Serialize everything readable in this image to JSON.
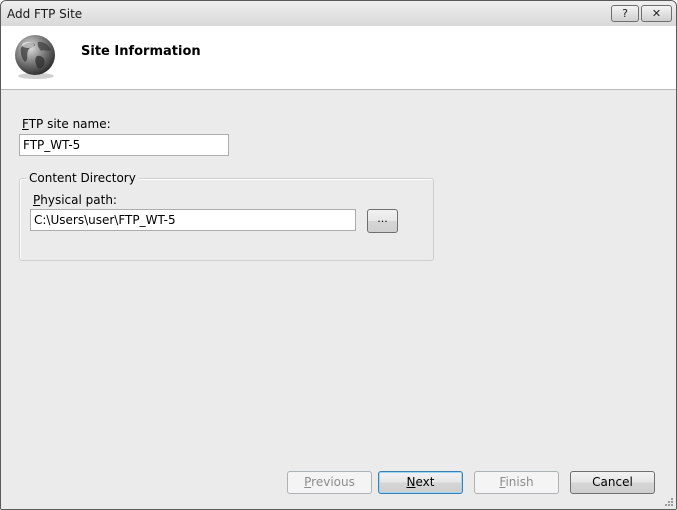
{
  "window": {
    "title": "Add FTP Site",
    "help_glyph": "?",
    "close_glyph": "✕"
  },
  "header": {
    "title": "Site Information",
    "icon": "globe-icon"
  },
  "form": {
    "site_name_label_accel": "F",
    "site_name_label_rest": "TP site name:",
    "site_name_value": "FTP_WT-5",
    "content_directory_legend": "Content Directory",
    "physical_path_label_accel": "P",
    "physical_path_label_rest": "hysical path:",
    "physical_path_value": "C:\\Users\\user\\FTP_WT-5",
    "browse_label": "..."
  },
  "buttons": {
    "previous_accel": "P",
    "previous_rest": "revious",
    "next_accel": "N",
    "next_rest": "ext",
    "finish_accel": "F",
    "finish_rest": "inish",
    "cancel": "Cancel"
  }
}
